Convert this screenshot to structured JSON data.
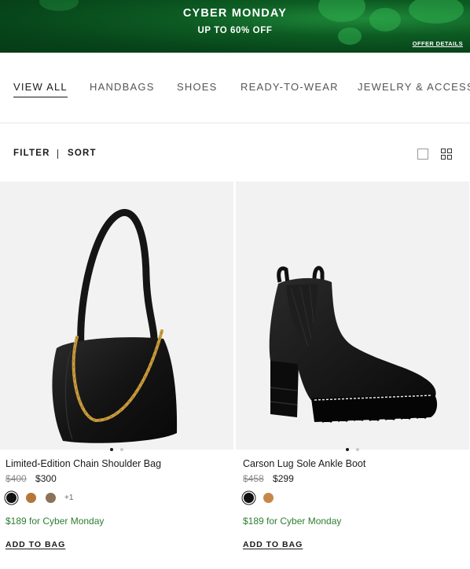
{
  "banner": {
    "title": "CYBER MONDAY",
    "subtitle": "UP TO 60% OFF",
    "offer_details": "OFFER DETAILS",
    "colors": {
      "background": "#0d5c23",
      "text": "#ffffff"
    }
  },
  "tabs": [
    {
      "label": "VIEW ALL",
      "active": true
    },
    {
      "label": "HANDBAGS",
      "active": false
    },
    {
      "label": "SHOES",
      "active": false
    },
    {
      "label": "READY-TO-WEAR",
      "active": false
    },
    {
      "label": "JEWELRY & ACCESS",
      "active": false
    }
  ],
  "toolbar": {
    "filter_label": "FILTER",
    "sort_label": "SORT",
    "view_icons": [
      "single-view-icon",
      "grid-view-icon"
    ]
  },
  "products": [
    {
      "name": "Limited-Edition Chain Shoulder Bag",
      "original_price": "$400",
      "sale_price": "$300",
      "swatches": [
        {
          "color": "#111111",
          "selected": true
        },
        {
          "color": "#b5763c",
          "selected": false
        },
        {
          "color": "#8a7356",
          "selected": false
        }
      ],
      "more_colors": "+1",
      "promo": "$189 for Cyber Monday",
      "add_to_bag": "ADD TO BAG",
      "image_icon": "shoulder-bag-image",
      "carousel_page": 1,
      "carousel_total": 2
    },
    {
      "name": "Carson Lug Sole Ankle Boot",
      "original_price": "$458",
      "sale_price": "$299",
      "swatches": [
        {
          "color": "#111111",
          "selected": true
        },
        {
          "color": "#c8874a",
          "selected": false
        }
      ],
      "more_colors": "",
      "promo": "$189 for Cyber Monday",
      "add_to_bag": "ADD TO BAG",
      "image_icon": "ankle-boot-image",
      "carousel_page": 1,
      "carousel_total": 2
    }
  ],
  "colors": {
    "promo_green": "#2e7d32",
    "image_background": "#f2f2f2",
    "strikethrough_gray": "#8a8a8a"
  }
}
